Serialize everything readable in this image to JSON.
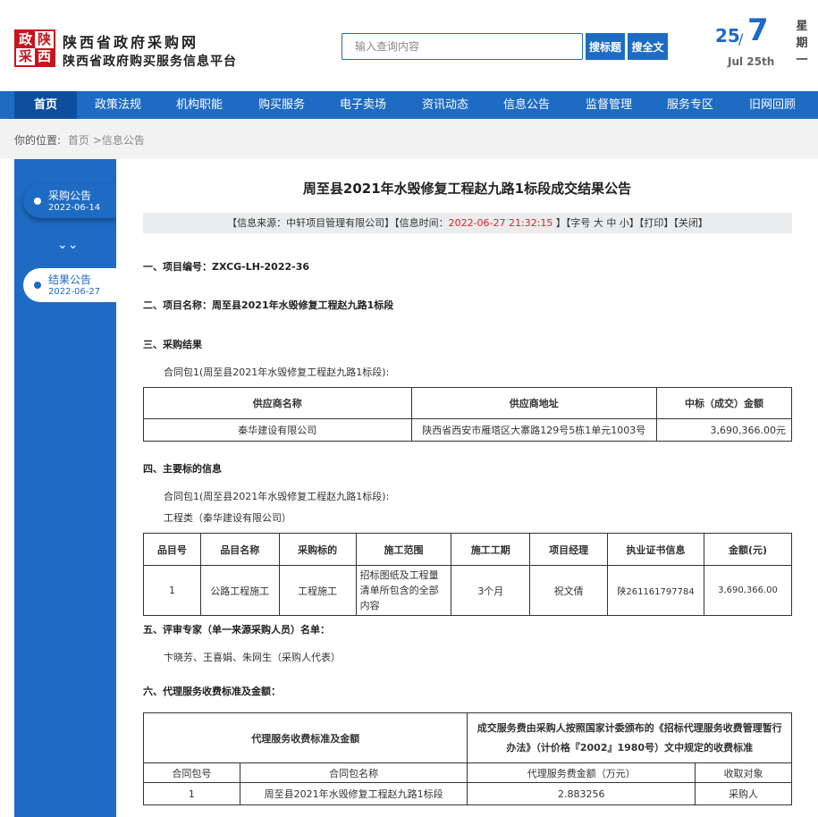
{
  "header": {
    "logo_chars": [
      "政",
      "陕",
      "采",
      "西"
    ],
    "site_title": "陕西省政府采购网",
    "site_subtitle": "陕西省政府购买服务信息平台",
    "search_placeholder": "输入查询内容",
    "btn_search_title": "搜标题",
    "btn_search_full": "搜全文",
    "date_day": "25",
    "date_slash": "/",
    "date_month": "7",
    "date_en": "Jul 25th",
    "weekday": "星期一"
  },
  "nav": {
    "items": [
      "首页",
      "政策法规",
      "机构职能",
      "购买服务",
      "电子卖场",
      "资讯动态",
      "信息公告",
      "监督管理",
      "服务专区",
      "旧网回顾"
    ],
    "active": 0
  },
  "breadcrumb": {
    "prefix": "你的位置:",
    "home": "首页",
    "sep": " >",
    "current": "信息公告"
  },
  "sidebar": {
    "cards": [
      {
        "title": "采购公告",
        "date": "2022-06-14"
      },
      {
        "title": "结果公告",
        "date": "2022-06-27"
      }
    ],
    "arrow": "⌄⌄"
  },
  "doc": {
    "title": "周至县2021年水毁修复工程赵九路1标段成交结果公告",
    "info_source": "【信息来源：中轩项目管理有限公司】【信息时间：",
    "info_time": "2022-06-27 21:32:15",
    "info_tail": " 】【字号 大 中 小】【打印】【关闭】",
    "sec1": "一、项目编号：ZXCG-LH-2022-36",
    "sec2": "二、项目名称：周至县2021年水毁修复工程赵九路1标段",
    "sec3": "三、采购结果",
    "sec3_para": "合同包1(周至县2021年水毁修复工程赵九路1标段):",
    "table1": {
      "headers": [
        "供应商名称",
        "供应商地址",
        "中标（成交）金额"
      ],
      "rows": [
        [
          "秦华建设有限公司",
          "陕西省西安市雁塔区大寨路129号5栋1单元1003号",
          "3,690,366.00元"
        ]
      ]
    },
    "sec4": "四、主要标的信息",
    "sec4_para1": "合同包1(周至县2021年水毁修复工程赵九路1标段):",
    "sec4_para2": "工程类（秦华建设有限公司）",
    "table2": {
      "headers": [
        "品目号",
        "品目名称",
        "采购标的",
        "施工范围",
        "施工工期",
        "项目经理",
        "执业证书信息",
        "金额(元)"
      ],
      "rows": [
        [
          "1",
          "公路工程施工",
          "工程施工",
          "招标图纸及工程量清单所包含的全部内容",
          "3个月",
          "祝文倩",
          "陕261161797784",
          "3,690,366.00"
        ]
      ]
    },
    "sec5": "五、评审专家（单一来源采购人员）名单：",
    "sec5_para": "卞晓芳、王喜娟、朱网生（采购人代表）",
    "sec6": "六、代理服务收费标准及金额：",
    "table3": {
      "head_left": "代理服务收费标准及金额",
      "head_right": "成交服务费由采购人按照国家计委颁布的《招标代理服务收费管理暂行办法》（计价格『2002』1980号）文中规定的收费标准",
      "sub_headers": [
        "合同包号",
        "合同包名称",
        "代理服务费金额（万元）",
        "收取对象"
      ],
      "rows": [
        [
          "1",
          "周至县2021年水毁修复工程赵九路1标段",
          "2.883256",
          "采购人"
        ]
      ]
    }
  }
}
